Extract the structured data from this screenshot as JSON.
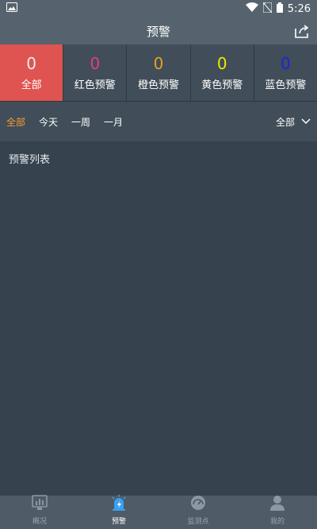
{
  "status_bar": {
    "time": "5:26"
  },
  "header": {
    "title": "预警"
  },
  "levels": [
    {
      "count": "0",
      "label": "全部",
      "color": "#ffffff",
      "active": true
    },
    {
      "count": "0",
      "label": "红色预警",
      "color": "#e2407a",
      "active": false
    },
    {
      "count": "0",
      "label": "橙色预警",
      "color": "#e8a020",
      "active": false
    },
    {
      "count": "0",
      "label": "黄色预警",
      "color": "#f2e600",
      "active": false
    },
    {
      "count": "0",
      "label": "蓝色预警",
      "color": "#1c24e0",
      "active": false
    }
  ],
  "filter": {
    "tabs": [
      "全部",
      "今天",
      "一周",
      "一月"
    ],
    "active_tab": 0,
    "dropdown_value": "全部"
  },
  "list": {
    "title": "预警列表"
  },
  "bottom_nav": [
    {
      "label": "概况",
      "icon": "chart-icon",
      "active": false
    },
    {
      "label": "预警",
      "icon": "alarm-icon",
      "active": true
    },
    {
      "label": "监测点",
      "icon": "gauge-icon",
      "active": false
    },
    {
      "label": "我的",
      "icon": "user-icon",
      "active": false
    }
  ],
  "colors": {
    "accent": "#f0a030",
    "active_level_bg": "#df5450",
    "nav_active_icon": "#3aa0f0"
  }
}
